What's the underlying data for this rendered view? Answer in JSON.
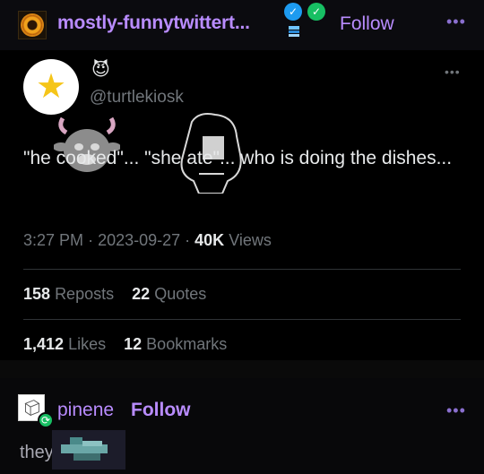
{
  "header": {
    "blog_name": "mostly-funnytwittert...",
    "follow_label": "Follow",
    "more_label": "•••",
    "verified_blue": "✓",
    "verified_green": "✓"
  },
  "tweet": {
    "avatar_icon": "star-icon",
    "emoji": "😈",
    "handle": "@turtlekiosk",
    "more_label": "•••",
    "text": "\"he cooked\"... \"she ate\"... who is doing the dishes...",
    "time": "3:27 PM",
    "date": "2023-09-27",
    "views_count": "40K",
    "views_label": "Views",
    "reposts_count": "158",
    "reposts_label": "Reposts",
    "quotes_count": "22",
    "quotes_label": "Quotes",
    "likes_count": "1,412",
    "likes_label": "Likes",
    "bookmarks_count": "12",
    "bookmarks_label": "Bookmarks"
  },
  "reblog": {
    "name": "pinene",
    "follow_label": "Follow",
    "more_label": "•••",
    "text": "they..."
  },
  "colors": {
    "accent": "#b98cff",
    "verified_blue": "#1d9bf0",
    "verified_green": "#17bf63",
    "muted": "#71767b"
  }
}
